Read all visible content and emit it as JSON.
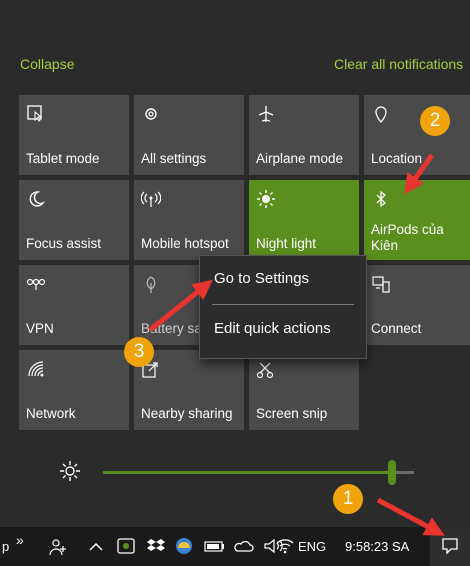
{
  "header": {
    "collapse": "Collapse",
    "clear": "Clear all notifications"
  },
  "tiles": [
    {
      "label": "Tablet mode",
      "icon": "tablet-mode-icon",
      "on": false
    },
    {
      "label": "All settings",
      "icon": "settings-gear-icon",
      "on": false
    },
    {
      "label": "Airplane mode",
      "icon": "airplane-icon",
      "on": false
    },
    {
      "label": "Location",
      "icon": "location-icon",
      "on": false
    },
    {
      "label": "Focus assist",
      "icon": "moon-icon",
      "on": false
    },
    {
      "label": "Mobile hotspot",
      "icon": "hotspot-icon",
      "on": false
    },
    {
      "label": "Night light",
      "icon": "sun-icon",
      "on": true
    },
    {
      "label": "AirPods của Kiên",
      "icon": "bluetooth-icon",
      "on": true
    },
    {
      "label": "VPN",
      "icon": "vpn-icon",
      "on": false
    },
    {
      "label": "Battery saver",
      "icon": "leaf-icon",
      "on": false
    },
    {
      "label": "",
      "icon": "",
      "on": false
    },
    {
      "label": "Connect",
      "icon": "connect-icon",
      "on": false
    },
    {
      "label": "Network",
      "icon": "network-icon",
      "on": false
    },
    {
      "label": "Nearby sharing",
      "icon": "nearby-sharing-icon",
      "on": false
    },
    {
      "label": "Screen snip",
      "icon": "screen-snip-icon",
      "on": false
    },
    {
      "label": "",
      "icon": "",
      "on": false
    }
  ],
  "context_menu": {
    "item1": "Go to Settings",
    "item2": "Edit quick actions"
  },
  "badges": [
    "1",
    "2",
    "3"
  ],
  "brightness": {
    "level": 0.93
  },
  "taskbar": {
    "lang": "ENG",
    "time": "9:58:23 SA",
    "left_fragment": "p"
  },
  "colors": {
    "accent": "#a6ce39",
    "tile": "#4a4a4a",
    "tile_on": "#5a8e1d",
    "badge": "#f0a30a",
    "arrow": "#e8342f"
  }
}
